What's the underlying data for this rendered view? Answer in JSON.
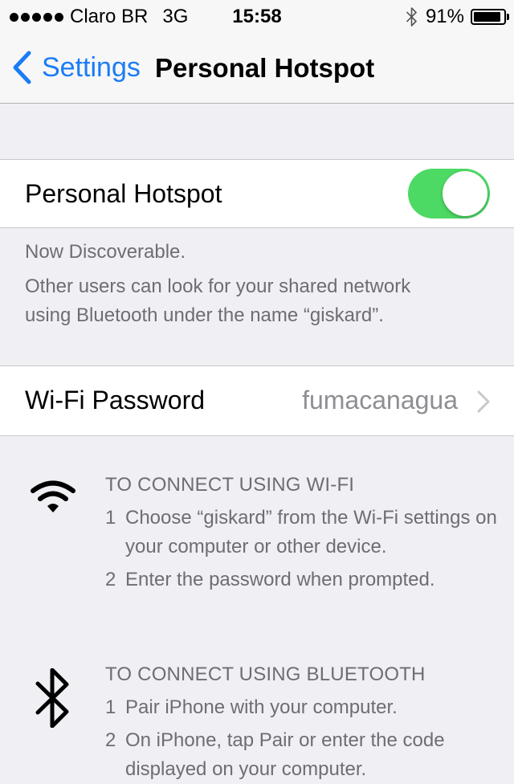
{
  "status_bar": {
    "carrier": "Claro BR",
    "network": "3G",
    "time": "15:58",
    "battery_percent": "91%",
    "battery_level": 0.91
  },
  "nav": {
    "back_label": "Settings",
    "title": "Personal Hotspot"
  },
  "hotspot": {
    "label": "Personal Hotspot",
    "enabled": true,
    "toggle_color": "#4cd964"
  },
  "discoverable": {
    "line1": "Now Discoverable.",
    "line2": "Other users can look for your shared network",
    "line3": "using Bluetooth under the name “giskard”."
  },
  "wifi_password": {
    "label": "Wi-Fi Password",
    "value": "fumacanagua"
  },
  "wifi_instructions": {
    "heading": "TO CONNECT USING WI-FI",
    "steps": [
      {
        "num": "1",
        "text": "Choose “giskard” from the Wi-Fi settings on your computer or other device."
      },
      {
        "num": "2",
        "text": "Enter the password when prompted."
      }
    ]
  },
  "bt_instructions": {
    "heading": "TO CONNECT USING BLUETOOTH",
    "steps": [
      {
        "num": "1",
        "text": "Pair iPhone with your computer."
      },
      {
        "num": "2",
        "text": "On iPhone, tap Pair or enter the code displayed on your computer."
      }
    ]
  },
  "colors": {
    "accent": "#1a7cf5",
    "background": "#efeff4",
    "secondary_text": "#6d6d72"
  }
}
